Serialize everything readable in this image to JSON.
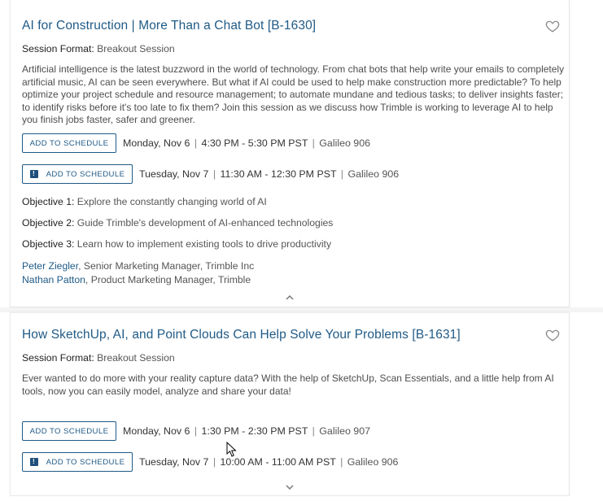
{
  "sessions": [
    {
      "title": "AI for Construction | More Than a Chat Bot [B-1630]",
      "format_label": "Session Format:",
      "format_value": "Breakout Session",
      "description": "Artificial intelligence is the latest buzzword in the world of technology. From chat bots that help write your emails to completely artificial music, AI can be seen everywhere. But what if AI could be used to help make construction more predictable? To help optimize your project schedule and resource management; to automate mundane and tedious tasks; to deliver insights faster; to identify risks before it's too late to fix them? Join this session as we discuss how Trimble is working to leverage AI to help you finish jobs faster, safer and greener.",
      "schedule": [
        {
          "button": "ADD TO SCHEDULE",
          "icon": false,
          "day": "Monday, Nov 6",
          "time": "4:30 PM - 5:30 PM PST",
          "location": "Galileo 906"
        },
        {
          "button": "ADD TO SCHEDULE",
          "icon": true,
          "day": "Tuesday, Nov 7",
          "time": "11:30 AM - 12:30 PM PST",
          "location": "Galileo 906"
        }
      ],
      "objectives": [
        {
          "label": "Objective 1:",
          "text": "Explore the constantly changing world of AI"
        },
        {
          "label": "Objective 2:",
          "text": "Guide Trimble's development of AI-enhanced technologies"
        },
        {
          "label": "Objective 3:",
          "text": "Learn how to implement existing tools to drive productivity"
        }
      ],
      "speakers": [
        {
          "name": "Peter Ziegler",
          "role": ", Senior Marketing Manager, Trimble Inc"
        },
        {
          "name": "Nathan Patton",
          "role": ", Product Marketing Manager, Trimble"
        }
      ],
      "toggle_icon": "chevron-up-icon"
    },
    {
      "title": "How SketchUp, AI, and Point Clouds Can Help Solve Your Problems [B-1631]",
      "format_label": "Session Format:",
      "format_value": "Breakout Session",
      "description": "Ever wanted to do more with your reality capture data? With the help of SketchUp, Scan Essentials, and a little help from AI tools, now you can easily model, analyze and share your data!",
      "schedule": [
        {
          "button": "ADD TO SCHEDULE",
          "icon": false,
          "day": "Monday, Nov 6",
          "time": "1:30 PM - 2:30 PM PST",
          "location": "Galileo 907"
        },
        {
          "button": "ADD TO SCHEDULE",
          "icon": true,
          "day": "Tuesday, Nov 7",
          "time": "10:00 AM - 11:00 AM PST",
          "location": "Galileo 906"
        }
      ],
      "toggle_icon": "chevron-down-icon"
    }
  ],
  "colors": {
    "accent": "#1f5a86",
    "text": "#333333",
    "muted": "#555555",
    "icon_fill": "#1f4f7a"
  },
  "separator": "|"
}
